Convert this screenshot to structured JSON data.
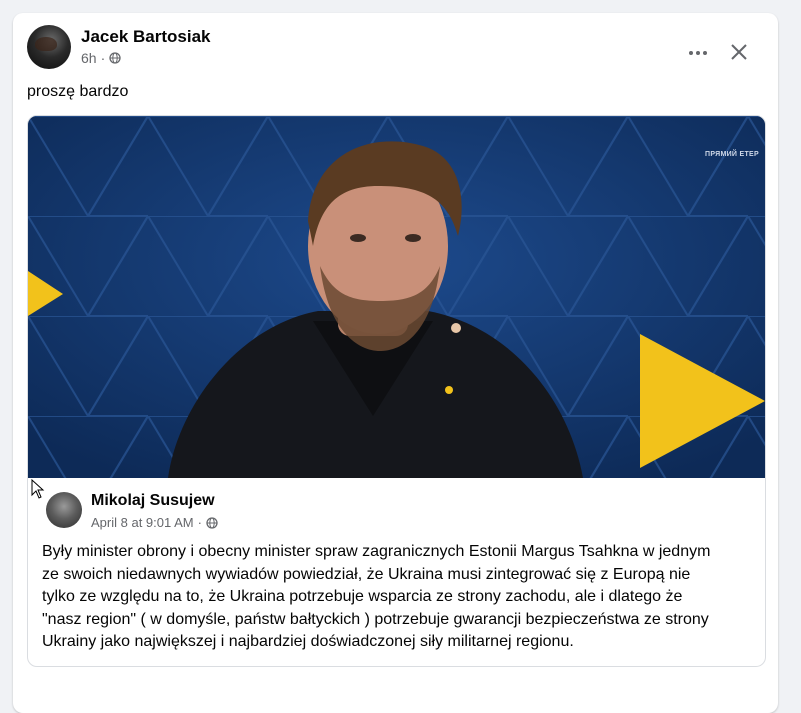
{
  "post": {
    "author": "Jacek Bartosiak",
    "time": "6h",
    "separator": "·",
    "privacy_icon": "globe-icon",
    "text": "proszę bardzo"
  },
  "header_actions": {
    "more_icon": "more-horizontal-icon",
    "close_icon": "close-icon"
  },
  "video": {
    "caption": "ПРЯМИЙ ЕТЕР",
    "colors": {
      "background": "#133a73",
      "accent_yellow": "#f2c21b"
    }
  },
  "shared_post": {
    "author": "Mikolaj Susujew",
    "time": "April 8 at 9:01 AM",
    "separator": "·",
    "privacy_icon": "globe-icon",
    "text_lines": [
      "Były minister obrony i obecny minister spraw zagranicznych Estonii Margus Tsahkna w jednym",
      "ze swoich niedawnych wywiadów powiedział, że Ukraina musi zintegrować się z Europą nie",
      "tylko ze względu na to, że Ukraina potrzebuje wsparcia ze strony zachodu, ale i dlatego że",
      "\"nasz region\" ( w domyśle, państw bałtyckich ) potrzebuje gwarancji bezpieczeństwa ze strony",
      "Ukrainy jako największej i najbardziej doświadczonej siły militarnej regionu."
    ]
  }
}
